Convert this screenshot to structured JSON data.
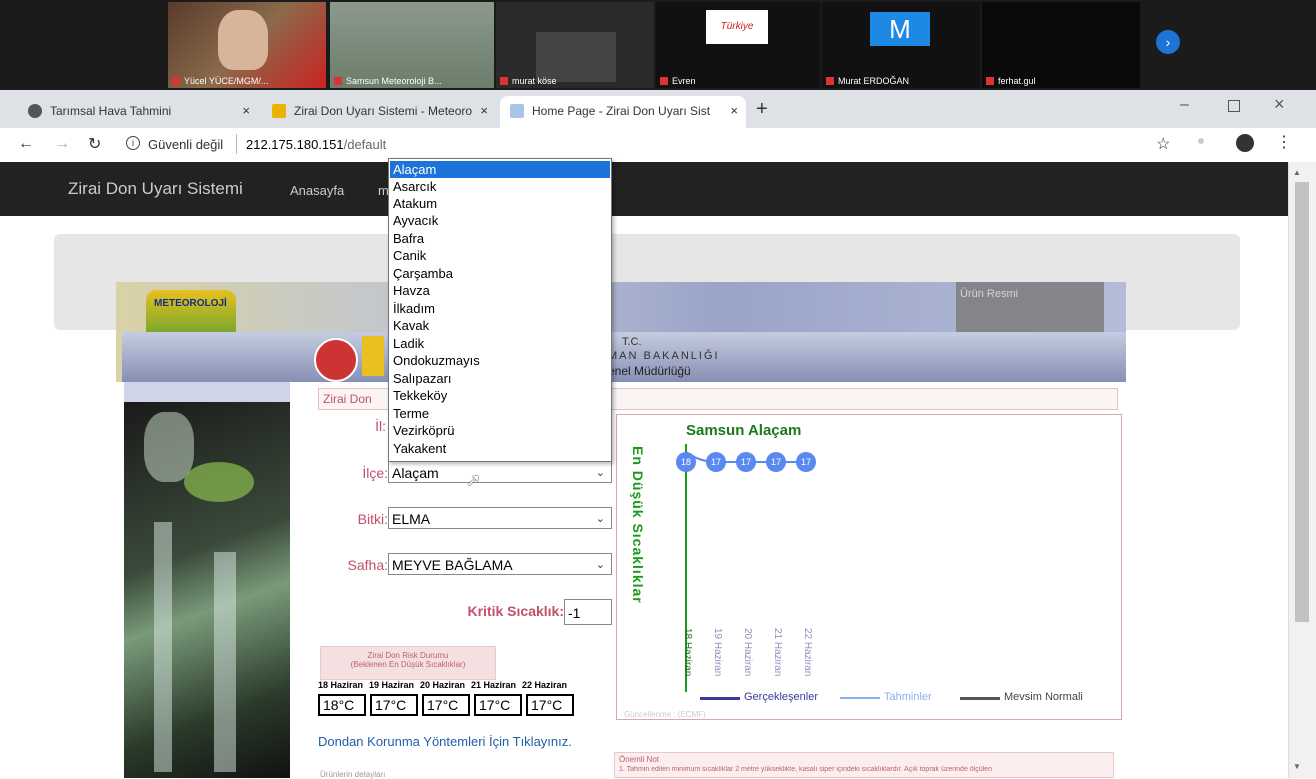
{
  "meeting": {
    "participants": [
      {
        "name": "Yücel YÜCE/MGM/..."
      },
      {
        "name": "Samsun Meteoroloji B..."
      },
      {
        "name": "murat köse"
      },
      {
        "name": "Evren"
      },
      {
        "name": "Murat ERDOĞAN",
        "initial": "M"
      },
      {
        "name": "ferhat.gul"
      }
    ],
    "logo_text": "Türkiye"
  },
  "browser": {
    "tabs": [
      {
        "title": "Tarımsal Hava Tahmini"
      },
      {
        "title": "Zirai Don Uyarı Sistemi - Meteoro"
      },
      {
        "title": "Home Page - Zirai Don Uyarı Sist"
      }
    ],
    "security_label": "Güvenli değil",
    "url_host": "212.175.180.151",
    "url_path": "/default"
  },
  "nav": {
    "brand": "Zirai Don Uyarı Sistemi",
    "home": "Anasayfa",
    "partial": "m"
  },
  "header": {
    "image_alt": "Ürün Resmi",
    "banner_tc": "T.C.",
    "banner_ministry": "MAN BAKANLIĞI",
    "banner_directorate": "enel Müdürlüğü",
    "logo_text": "METEOROLOJİ",
    "section_title": "Zirai Don"
  },
  "form": {
    "il_label": "İl:",
    "ilce_label": "İlçe:",
    "ilce_value": "Alaçam",
    "bitki_label": "Bitki:",
    "bitki_value": "ELMA",
    "safha_label": "Safha:",
    "safha_value": "MEYVE BAĞLAMA",
    "kritik_label": "Kritik Sıcaklık:",
    "kritik_value": "-1"
  },
  "dropdown_options": [
    "Alaçam",
    "Asarcık",
    "Atakum",
    "Ayvacık",
    "Bafra",
    "Canik",
    "Çarşamba",
    "Havza",
    "İlkadım",
    "Kavak",
    "Ladik",
    "Ondokuzmayıs",
    "Salıpazarı",
    "Tekkeköy",
    "Terme",
    "Vezirköprü",
    "Yakakent"
  ],
  "risk": {
    "title1": "Zirai Don Risk Durumu",
    "title2": "(Beklenen En Düşük Sıcaklıklar)",
    "dates": [
      "18 Haziran",
      "19 Haziran",
      "20 Haziran",
      "21 Haziran",
      "22 Haziran"
    ],
    "temps": [
      "18°C",
      "17°C",
      "17°C",
      "17°C",
      "17°C"
    ]
  },
  "protect_link": "Dondan Korunma Yöntemleri İçin Tıklayınız.",
  "note_title": "Önemli Not",
  "note_text": "1. Tahmin edilen minimum sıcaklıklar 2 metre yükseklikte, kasalı siper içindeki sıcaklıklardır. Açık toprak üzerinde ölçülen",
  "footer_partial": "Ürünlerin detayları",
  "chart": {
    "title": "Samsun Alaçam",
    "ylabel": "En Düşük Sıcaklıklar",
    "legend": [
      "Gerçekleşenler",
      "Tahminler",
      "Mevsim Normali"
    ],
    "updated": "Güncellenme : (ECMF)"
  },
  "chart_data": {
    "type": "line",
    "x": [
      "18 Haziran",
      "19 Haziran",
      "20 Haziran",
      "21 Haziran",
      "22 Haziran"
    ],
    "series": [
      {
        "name": "Gerçekleşenler",
        "values": [
          18,
          null,
          null,
          null,
          null
        ]
      },
      {
        "name": "Tahminler",
        "values": [
          18,
          17,
          17,
          17,
          17
        ]
      }
    ],
    "data_labels": [
      "18",
      "17",
      "17",
      "17",
      "17"
    ],
    "title": "Samsun Alaçam",
    "ylabel": "En Düşük Sıcaklıklar",
    "legend": [
      "Gerçekleşenler",
      "Tahminler",
      "Mevsim Normali"
    ]
  },
  "colors": {
    "accent": "#1e73d8",
    "label": "#c0506b",
    "chart_green": "#1a9a1a",
    "chart_blue": "#5a8af0",
    "nav_bg": "#222222"
  }
}
